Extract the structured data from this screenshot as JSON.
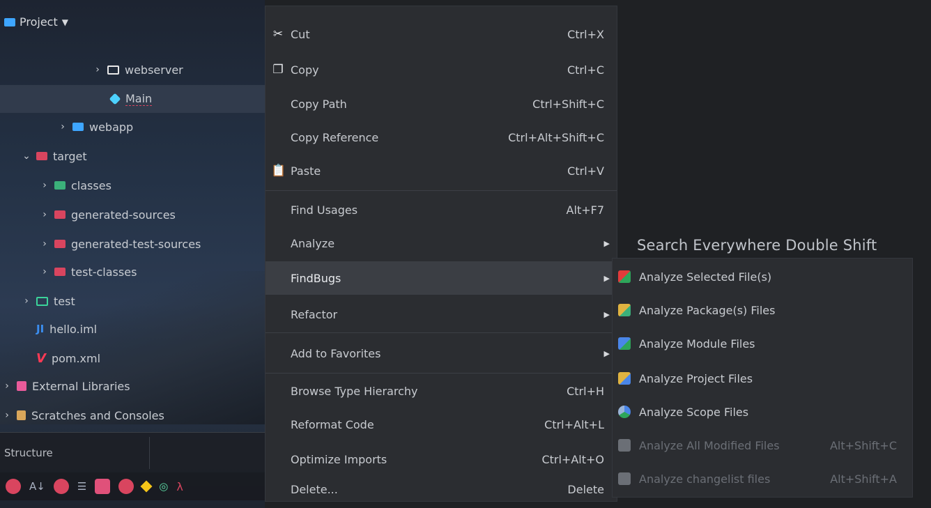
{
  "project": {
    "header": "Project",
    "tree": [
      {
        "label": "webserver"
      },
      {
        "label": "Main"
      },
      {
        "label": "webapp"
      },
      {
        "label": "target"
      },
      {
        "label": "classes"
      },
      {
        "label": "generated-sources"
      },
      {
        "label": "generated-test-sources"
      },
      {
        "label": "test-classes"
      },
      {
        "label": "test"
      },
      {
        "label": "hello.iml"
      },
      {
        "label": "pom.xml"
      },
      {
        "label": "External Libraries"
      },
      {
        "label": "Scratches and Consoles"
      }
    ],
    "structure_label": "Structure"
  },
  "context_menu": {
    "items": [
      {
        "label": "Cut",
        "shortcut": "Ctrl+X"
      },
      {
        "label": "Copy",
        "shortcut": "Ctrl+C"
      },
      {
        "label": "Copy Path",
        "shortcut": "Ctrl+Shift+C"
      },
      {
        "label": "Copy Reference",
        "shortcut": "Ctrl+Alt+Shift+C"
      },
      {
        "label": "Paste",
        "shortcut": "Ctrl+V"
      },
      {
        "label": "Find Usages",
        "shortcut": "Alt+F7"
      },
      {
        "label": "Analyze",
        "shortcut": ""
      },
      {
        "label": "FindBugs",
        "shortcut": ""
      },
      {
        "label": "Refactor",
        "shortcut": ""
      },
      {
        "label": "Add to Favorites",
        "shortcut": ""
      },
      {
        "label": "Browse Type Hierarchy",
        "shortcut": "Ctrl+H"
      },
      {
        "label": "Reformat Code",
        "shortcut": "Ctrl+Alt+L"
      },
      {
        "label": "Optimize Imports",
        "shortcut": "Ctrl+Alt+O"
      },
      {
        "label": "Delete...",
        "shortcut": "Delete"
      }
    ]
  },
  "search_hint": "Search Everywhere  Double Shift",
  "findbugs_submenu": {
    "items": [
      {
        "label": "Analyze Selected File(s)",
        "shortcut": "",
        "enabled": true
      },
      {
        "label": "Analyze Package(s) Files",
        "shortcut": "",
        "enabled": true
      },
      {
        "label": "Analyze Module Files",
        "shortcut": "",
        "enabled": true
      },
      {
        "label": "Analyze Project Files",
        "shortcut": "",
        "enabled": true
      },
      {
        "label": "Analyze Scope Files",
        "shortcut": "",
        "enabled": true
      },
      {
        "label": "Analyze All Modified Files",
        "shortcut": "Alt+Shift+C",
        "enabled": false
      },
      {
        "label": "Analyze changelist files",
        "shortcut": "Alt+Shift+A",
        "enabled": false
      }
    ]
  },
  "colors": {
    "menu_bg": "#2b2d31",
    "highlight": "#3b3e44",
    "folder_red": "#d9455f",
    "accent_blue": "#3ea6ff"
  }
}
